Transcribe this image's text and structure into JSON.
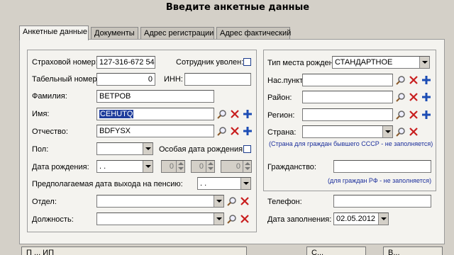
{
  "window": {
    "title": "Введите анкетные данные"
  },
  "tabs": [
    {
      "label": "Анкетные данные"
    },
    {
      "label": "Документы"
    },
    {
      "label": "Адрес регистрации"
    },
    {
      "label": "Адрес фактический"
    }
  ],
  "form": {
    "insurance_number": {
      "label": "Страховой номер:",
      "value": "127-316-672 54"
    },
    "employee_fired": {
      "label": "Сотрудник уволен:",
      "checked": false
    },
    "personnel_number": {
      "label": "Табельный номер:",
      "value": "0"
    },
    "inn": {
      "label": "ИНН:",
      "value": ""
    },
    "surname": {
      "label": "Фамилия:",
      "value": "ВЕТРОВ"
    },
    "name": {
      "label": "Имя:",
      "value": "CEHUTQ"
    },
    "patronymic": {
      "label": "Отчество:",
      "value": "BDFYSX"
    },
    "sex": {
      "label": "Пол:",
      "value": ""
    },
    "special_birth_date": {
      "label": "Особая дата рождения:",
      "checked": false
    },
    "birth_date": {
      "label": "Дата рождения:",
      "value": ". ."
    },
    "birth_spin": [
      "0",
      "0",
      "0"
    ],
    "pension_date": {
      "label": "Предполагаемая дата выхода на пенсию:",
      "value": ". ."
    },
    "department": {
      "label": "Отдел:",
      "value": ""
    },
    "position": {
      "label": "Должность:",
      "value": ""
    }
  },
  "birthplace": {
    "type": {
      "label": "Тип места рожден:",
      "value": "СТАНДАРТНОЕ"
    },
    "locality": {
      "label": "Нас.пункт:",
      "value": ""
    },
    "district": {
      "label": "Район:",
      "value": ""
    },
    "region": {
      "label": "Регион:",
      "value": ""
    },
    "country": {
      "label": "Страна:",
      "value": ""
    },
    "country_note": "(Страна для граждан бывшего СССР - не заполняется)",
    "citizenship": {
      "label": "Гражданство:",
      "value": ""
    },
    "citizenship_note": "(для граждан РФ - не заполняется)"
  },
  "contact": {
    "phone": {
      "label": "Телефон:",
      "value": ""
    },
    "fill_date": {
      "label": "Дата заполнения:",
      "value": "02.05.2012"
    }
  },
  "buttons": {
    "bottom_left": "П ... ИП",
    "save": "С...",
    "exit": "В..."
  },
  "colors": {
    "background": "#d4d0c8",
    "panel": "#f4f3ef",
    "selection": "#1f3d9c",
    "delete_icon": "#c81e1e",
    "add_icon": "#1c4cb4",
    "note_text": "#1c2f9c"
  }
}
